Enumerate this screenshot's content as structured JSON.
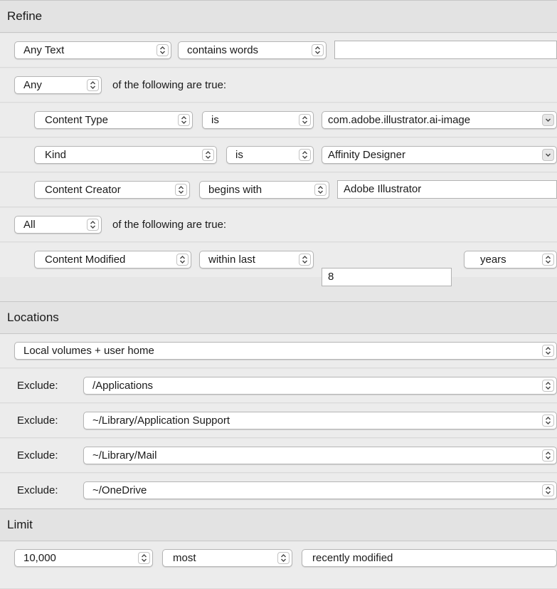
{
  "refine": {
    "title": "Refine",
    "rows": {
      "text": {
        "field": "Any Text",
        "operator": "contains words",
        "value": ""
      },
      "group1": {
        "quantifier": "Any",
        "label": "of the following are true:"
      },
      "content_type": {
        "field": "Content Type",
        "operator": "is",
        "value": "com.adobe.illustrator.ai-image"
      },
      "kind": {
        "field": "Kind",
        "operator": "is",
        "value": "Affinity Designer"
      },
      "creator": {
        "field": "Content Creator",
        "operator": "begins with",
        "value": "Adobe Illustrator"
      },
      "group2": {
        "quantifier": "All",
        "label": "of the following are true:"
      },
      "modified": {
        "field": "Content Modified",
        "operator": "within last",
        "value": "8",
        "unit": "years"
      }
    }
  },
  "locations": {
    "title": "Locations",
    "scope": "Local volumes + user home",
    "exclude_label": "Exclude:",
    "excludes": [
      "/Applications",
      "~/Library/Application Support",
      "~/Library/Mail",
      "~/OneDrive"
    ]
  },
  "limit": {
    "title": "Limit",
    "count": "10,000",
    "order": "most",
    "sort": "recently modified"
  },
  "icons": {
    "popup_arrow": "updown-chevron-icon",
    "dropdown_arrow": "chevron-down-icon"
  }
}
